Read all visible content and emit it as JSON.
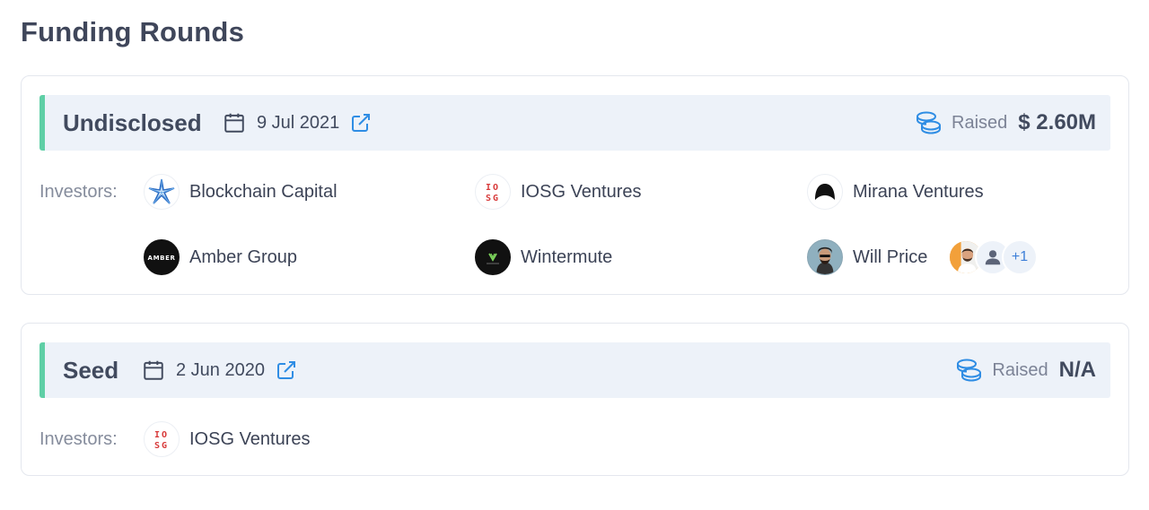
{
  "page": {
    "title": "Funding Rounds"
  },
  "rounds": [
    {
      "type": "Undisclosed",
      "date": "9 Jul 2021",
      "raised_label": "Raised",
      "raised_amount": "$ 2.60M",
      "investors_label": "Investors:",
      "investors": [
        {
          "name": "Blockchain Capital",
          "logo": "blockchain-capital-logo"
        },
        {
          "name": "IOSG Ventures",
          "logo": "iosg-ventures-logo"
        },
        {
          "name": "Mirana Ventures",
          "logo": "mirana-ventures-logo"
        },
        {
          "name": "Amber Group",
          "logo": "amber-group-logo"
        },
        {
          "name": "Wintermute",
          "logo": "wintermute-logo"
        },
        {
          "name": "Will Price",
          "logo": "will-price-avatar"
        }
      ],
      "more_investors": {
        "count_label": "+1"
      }
    },
    {
      "type": "Seed",
      "date": "2 Jun 2020",
      "raised_label": "Raised",
      "raised_amount": "N/A",
      "investors_label": "Investors:",
      "investors": [
        {
          "name": "IOSG Ventures",
          "logo": "iosg-ventures-logo"
        }
      ]
    }
  ],
  "logos": {
    "amber_text": "AMBER",
    "iosg_top": "IO",
    "iosg_bottom": "SG"
  },
  "colors": {
    "accent_green": "#5fcfa6",
    "link_blue": "#2f8de4",
    "header_bg": "#edf2f9",
    "iosg_red": "#d83a3a"
  }
}
